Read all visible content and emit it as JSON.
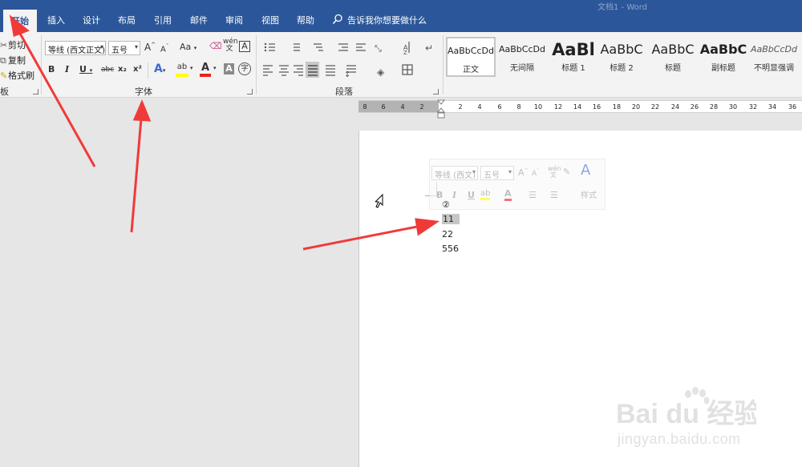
{
  "title_bar": {
    "faded_text": "文档1 - Word"
  },
  "tabs": [
    {
      "label": "开始",
      "active": true
    },
    {
      "label": "插入"
    },
    {
      "label": "设计"
    },
    {
      "label": "布局"
    },
    {
      "label": "引用"
    },
    {
      "label": "邮件"
    },
    {
      "label": "审阅"
    },
    {
      "label": "视图"
    },
    {
      "label": "帮助"
    }
  ],
  "tell_me": {
    "text": "告诉我你想要做什么",
    "icon": "lightbulb-icon"
  },
  "clipboard": {
    "items": [
      {
        "label": "剪切",
        "icon": "scissors-icon"
      },
      {
        "label": "复制",
        "icon": "copy-icon"
      },
      {
        "label": "格式刷",
        "icon": "format-painter-icon"
      }
    ],
    "group_label": "板"
  },
  "font_group": {
    "font_name": "等线 (西文正文)",
    "font_size": "五号",
    "grow_font": "A",
    "shrink_font": "A",
    "change_case": "Aa",
    "clear_format_icon": "eraser-icon",
    "phonetic": "wén 文",
    "char_border": "A",
    "bold": "B",
    "italic": "I",
    "underline": "U",
    "strikethrough": "abc",
    "subscript": "x₂",
    "superscript": "x²",
    "text_effects": "A",
    "highlight": "ab",
    "font_color": "A",
    "char_shading": "A",
    "enclose_char": "字",
    "group_label": "字体"
  },
  "paragraph_group": {
    "group_label": "段落"
  },
  "styles": [
    {
      "sample": "AaBbCcDd",
      "name": "正文",
      "selected": true,
      "size": "11px",
      "weight": "normal"
    },
    {
      "sample": "AaBbCcDd",
      "name": "无间隔",
      "size": "11px",
      "weight": "normal"
    },
    {
      "sample": "AaBl",
      "name": "标题 1",
      "size": "21px",
      "weight": "bold"
    },
    {
      "sample": "AaBbC",
      "name": "标题 2",
      "size": "16px",
      "weight": "normal"
    },
    {
      "sample": "AaBbC",
      "name": "标题",
      "size": "16px",
      "weight": "normal"
    },
    {
      "sample": "AaBbC",
      "name": "副标题",
      "size": "16px",
      "weight": "bold"
    },
    {
      "sample": "AaBbCcDd",
      "name": "不明显强调",
      "size": "11px",
      "weight": "normal",
      "italic": true
    }
  ],
  "ruler": {
    "ticks": [
      "8",
      "6",
      "4",
      "2",
      "2",
      "4",
      "6",
      "8",
      "10",
      "12",
      "14",
      "16",
      "18",
      "20",
      "22",
      "24",
      "26",
      "28",
      "30",
      "32",
      "34",
      "36"
    ]
  },
  "mini_toolbar": {
    "font_name": "等线 (西文)",
    "font_size": "五号",
    "styles_label": "样式"
  },
  "document": {
    "lines": [
      "②",
      "11",
      "22",
      "556"
    ]
  },
  "watermark": {
    "logo_text": "Baidu 经验",
    "url": "jingyan.baidu.com"
  },
  "colors": {
    "ribbon_blue": "#2b579a",
    "arrow_red": "#f03a3a",
    "highlight_yellow": "#ffff00",
    "font_red": "#e8231f"
  }
}
